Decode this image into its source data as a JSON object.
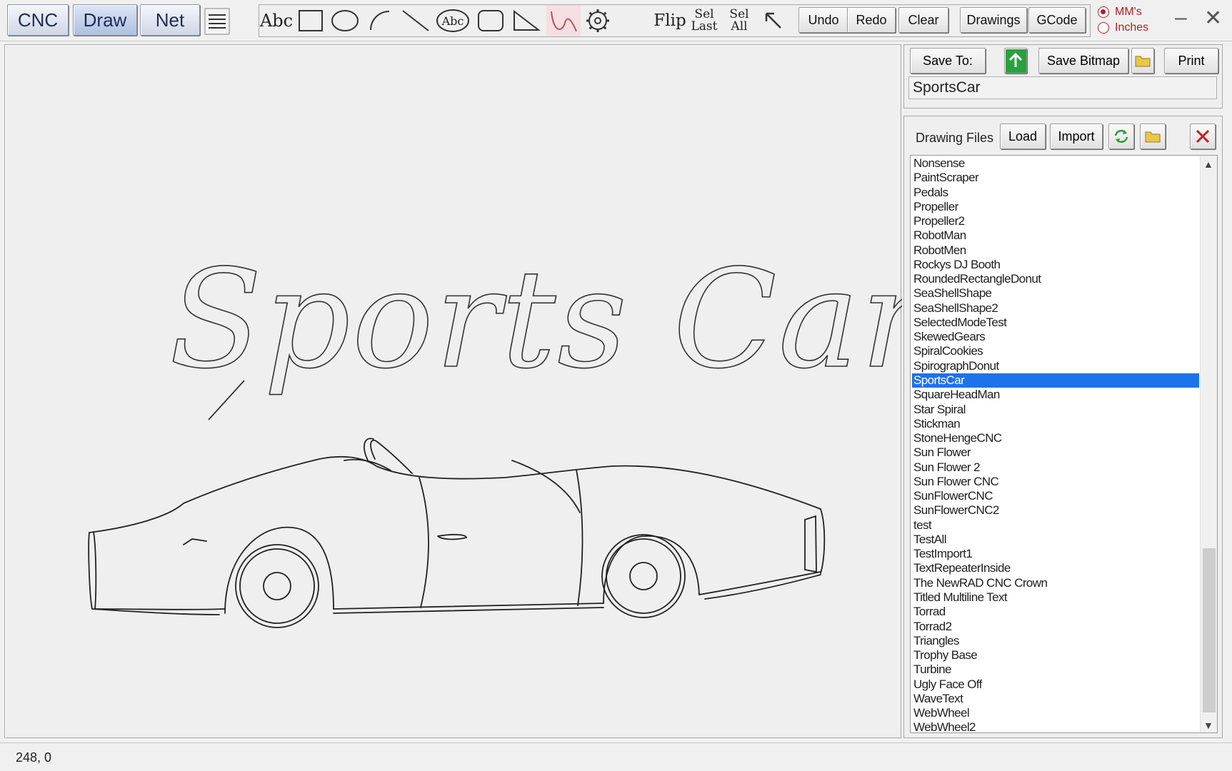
{
  "nav_tabs": [
    "CNC",
    "Draw",
    "Net"
  ],
  "tools": {
    "text": "Abc",
    "text_oval": "Abc",
    "flip": "Flip",
    "sel_last": [
      "Sel",
      "Last"
    ],
    "sel_all": [
      "Sel",
      "All"
    ],
    "undo": "Undo",
    "redo": "Redo",
    "clear": "Clear",
    "drawings": "Drawings",
    "gcode": "GCode"
  },
  "units": {
    "mm": "MM's",
    "inches": "Inches",
    "selected": "mm"
  },
  "save": {
    "save_to": "Save To:",
    "save_bitmap": "Save Bitmap",
    "print": "Print",
    "filename": "SportsCar"
  },
  "files": {
    "label": "Drawing Files",
    "load": "Load",
    "import": "Import",
    "selected_index": 15,
    "items": [
      "Nonsense",
      "PaintScraper",
      "Pedals",
      "Propeller",
      "Propeller2",
      "RobotMan",
      "RobotMen",
      "Rockys DJ Booth",
      "RoundedRectangleDonut",
      "SeaShellShape",
      "SeaShellShape2",
      "SelectedModeTest",
      "SkewedGears",
      "SpiralCookies",
      "SpirographDonut",
      "SportsCar",
      "SquareHeadMan",
      "Star Spiral",
      "Stickman",
      "StoneHengeCNC",
      "Sun Flower",
      "Sun Flower 2",
      "Sun Flower CNC",
      "SunFlowerCNC",
      "SunFlowerCNC2",
      "test",
      "TestAll",
      "TestImport1",
      "TextRepeaterInside",
      "The NewRAD CNC Crown",
      "Titled Multiline Text",
      "Torrad",
      "Torrad2",
      "Triangles",
      "Trophy Base",
      "Turbine",
      "Ugly Face Off",
      "WaveText",
      "WebWheel",
      "WebWheel2"
    ]
  },
  "status": {
    "coords": "248, 0"
  },
  "canvas": {
    "drawing_text": "Sports Car"
  }
}
